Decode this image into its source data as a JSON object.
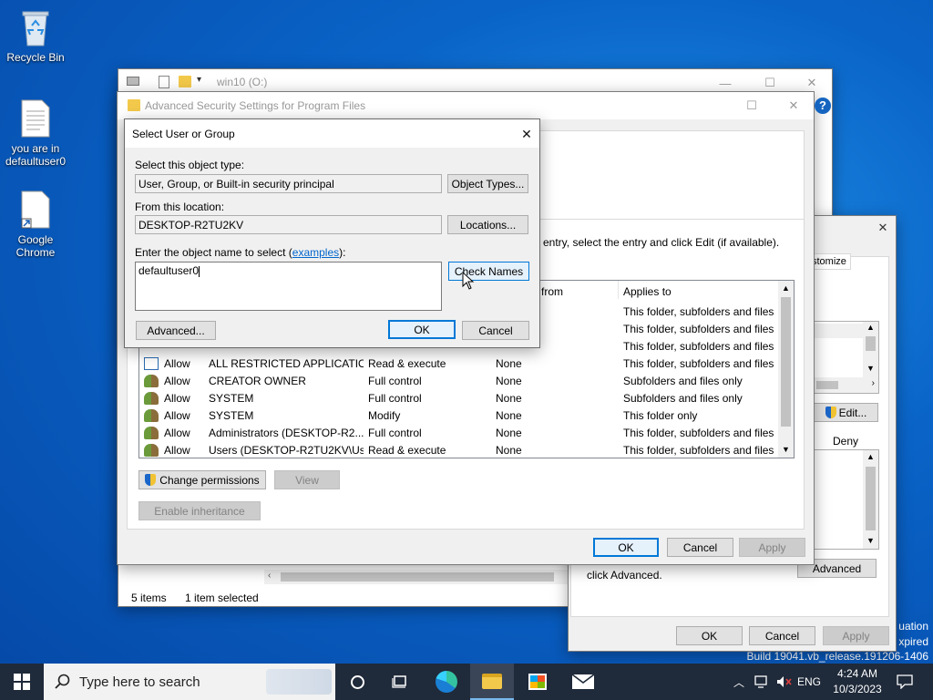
{
  "desktop": {
    "icons": [
      {
        "label": "Recycle Bin"
      },
      {
        "label": "you are in defaultuser0"
      },
      {
        "label": "Google Chrome"
      }
    ],
    "watermark": {
      "line1": "uation",
      "line2": "xpired",
      "build": "Build 19041.vb_release.191206-1406"
    }
  },
  "explorer": {
    "title": "win10 (O:)",
    "status_items": "5 items",
    "status_selected": "1 item selected"
  },
  "advanced_security": {
    "title": "Advanced Security Settings for Program Files",
    "instruction": "entry, select the entry and click Edit (if available).",
    "columns": {
      "inherited_from": "from",
      "applies_to": "Applies to"
    },
    "rows": [
      {
        "type": "",
        "principal": "",
        "access": "",
        "inherited": "",
        "applies": "This folder, subfolders and files"
      },
      {
        "type": "",
        "principal": "",
        "access": "",
        "inherited": "",
        "applies": "This folder, subfolders and files"
      },
      {
        "type": "",
        "principal": "",
        "access": "",
        "inherited": "",
        "applies": "This folder, subfolders and files"
      },
      {
        "type": "Allow",
        "principal": "ALL RESTRICTED APPLICATIO...",
        "access": "Read & execute",
        "inherited": "None",
        "applies": "This folder, subfolders and files"
      },
      {
        "type": "Allow",
        "principal": "CREATOR OWNER",
        "access": "Full control",
        "inherited": "None",
        "applies": "Subfolders and files only"
      },
      {
        "type": "Allow",
        "principal": "SYSTEM",
        "access": "Full control",
        "inherited": "None",
        "applies": "Subfolders and files only"
      },
      {
        "type": "Allow",
        "principal": "SYSTEM",
        "access": "Modify",
        "inherited": "None",
        "applies": "This folder only"
      },
      {
        "type": "Allow",
        "principal": "Administrators (DESKTOP-R2...",
        "access": "Full control",
        "inherited": "None",
        "applies": "This folder, subfolders and files"
      },
      {
        "type": "Allow",
        "principal": "Users (DESKTOP-R2TU2KV\\Us...",
        "access": "Read & execute",
        "inherited": "None",
        "applies": "This folder, subfolders and files"
      }
    ],
    "change_permissions": "Change permissions",
    "view": "View",
    "enable_inheritance": "Enable inheritance",
    "ok": "OK",
    "cancel": "Cancel",
    "apply": "Apply"
  },
  "properties": {
    "customize_tab": "stomize",
    "edit": "Edit...",
    "deny": "Deny",
    "special_text": "For special permissions or advanced settings, click Advanced.",
    "special_text_visible": "click Advanced.",
    "advanced": "Advanced",
    "ok": "OK",
    "cancel": "Cancel",
    "apply": "Apply"
  },
  "select_user": {
    "title": "Select User or Group",
    "object_type_label": "Select this object type:",
    "object_type_value": "User, Group, or Built-in security principal",
    "object_types_button": "Object Types...",
    "location_label": "From this location:",
    "location_value": "DESKTOP-R2TU2KV",
    "locations_button": "Locations...",
    "enter_label": "Enter the object name to select (",
    "examples_link": "examples",
    "enter_label_end": "):",
    "name_value": "defaultuser0",
    "check_names_button": "Check Names",
    "advanced_button": "Advanced...",
    "ok_button": "OK",
    "cancel_button": "Cancel"
  },
  "taskbar": {
    "search_placeholder": "Type here to search",
    "lang": "ENG",
    "time": "4:24 AM",
    "date": "10/3/2023"
  }
}
